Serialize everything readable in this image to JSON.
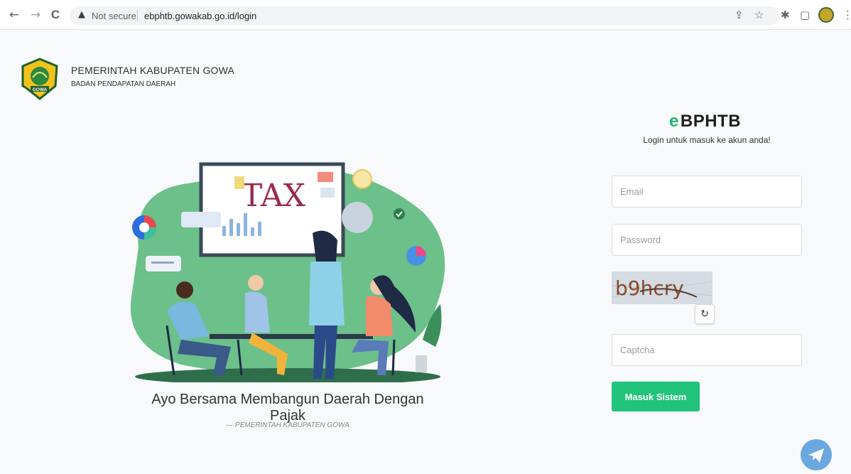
{
  "browser": {
    "back": "←",
    "forward": "→",
    "reload": "C",
    "security_icon": "▲",
    "security_text": "Not secure",
    "url": "ebphtb.gowakab.go.id/login",
    "icons": [
      "share-icon",
      "star-icon",
      "extensions-icon",
      "sidepanel-icon",
      "profile-avatar",
      "menu-icon"
    ]
  },
  "header": {
    "org_name": "PEMERINTAH KABUPATEN GOWA",
    "org_subtitle": "BADAN PENDAPATAN DAERAH",
    "logo_text": "GOWA"
  },
  "illustration": {
    "board_text": "TAX"
  },
  "hero": {
    "tagline": "Ayo Bersama Membangun Daerah Dengan Pajak",
    "attribution": "— PEMERINTAH KABUPATEN GOWA"
  },
  "login": {
    "brand_icon": "e",
    "brand_name": "BPHTB",
    "subtitle": "Login untuk masuk ke akun anda!",
    "email_placeholder": "Email",
    "password_placeholder": "Password",
    "captcha_text": "b9hcry",
    "captcha_placeholder": "Captcha",
    "submit_label": "Masuk Sistem"
  },
  "colors": {
    "accent": "#22c37a",
    "illustration_green": "#6cc08a",
    "telegram": "#6aa8e0"
  }
}
